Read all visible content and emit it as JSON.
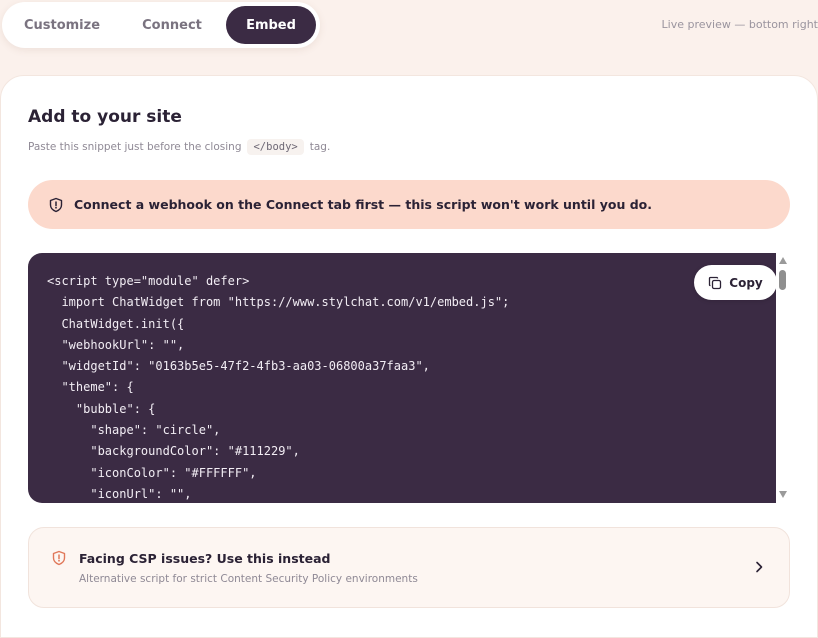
{
  "tabs": [
    {
      "label": "Customize",
      "active": false
    },
    {
      "label": "Connect",
      "active": false
    },
    {
      "label": "Embed",
      "active": true
    }
  ],
  "live_preview": "Live preview — bottom right",
  "section": {
    "title": "Add to your site",
    "subtitle_prefix": "Paste this snippet just before the closing",
    "subtitle_code": "</body>",
    "subtitle_suffix": "tag."
  },
  "warning": {
    "icon": "shield-alert-icon",
    "text": "Connect a webhook on the Connect tab first — this script won't work until you do."
  },
  "code": {
    "copy_label": "Copy",
    "copy_icon": "copy-icon",
    "lines": [
      "<script type=\"module\" defer>",
      "  import ChatWidget from \"https://www.stylchat.com/v1/embed.js\";",
      "  ChatWidget.init({",
      "  \"webhookUrl\": \"\",",
      "  \"widgetId\": \"0163b5e5-47f2-4fb3-aa03-06800a37faa3\",",
      "  \"theme\": {",
      "    \"bubble\": {",
      "      \"shape\": \"circle\",",
      "      \"backgroundColor\": \"#111229\",",
      "      \"iconColor\": \"#FFFFFF\",",
      "      \"iconUrl\": \"\","
    ]
  },
  "csp": {
    "icon": "shield-alert-icon",
    "title": "Facing CSP issues? Use this instead",
    "description": "Alternative script for strict Content Security Policy environments",
    "chevron_icon": "chevron-right-icon"
  },
  "colors": {
    "accent_dark": "#3b2b44",
    "warning_bg": "#fcd9cc",
    "page_bg": "#fbf1ec",
    "csp_icon": "#e0785a"
  }
}
